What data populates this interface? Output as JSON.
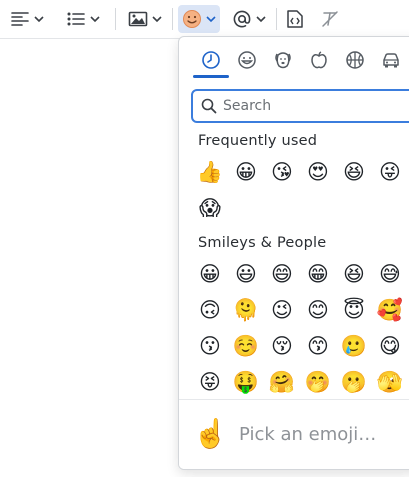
{
  "toolbar": {
    "buttons": [
      {
        "icon": "align-left-icon"
      },
      {
        "icon": "bulleted-list-icon"
      },
      {
        "icon": "image-icon"
      },
      {
        "icon": "emoji-icon"
      },
      {
        "icon": "mention-icon"
      },
      {
        "icon": "code-snippet-icon"
      },
      {
        "icon": "clear-formatting-icon"
      }
    ],
    "accent": "#dbe5f6"
  },
  "emoji_picker": {
    "categories": [
      {
        "name": "recent",
        "icon": "clock-icon"
      },
      {
        "name": "smileys",
        "icon": "smiley-icon"
      },
      {
        "name": "animals",
        "icon": "dog-icon"
      },
      {
        "name": "food",
        "icon": "apple-icon"
      },
      {
        "name": "activity",
        "icon": "basketball-icon"
      },
      {
        "name": "travel",
        "icon": "car-icon"
      }
    ],
    "search_placeholder": "Search",
    "sections": {
      "frequent": {
        "title": "Frequently used",
        "emojis": [
          "👍",
          "😀",
          "😘",
          "😍",
          "😆",
          "😜",
          "😱"
        ]
      },
      "smileys": {
        "title": "Smileys & People",
        "emojis": [
          "😀",
          "😃",
          "😄",
          "😁",
          "😆",
          "😅",
          "🙃",
          "🫠",
          "😉",
          "😊",
          "😇",
          "🥰",
          "😗",
          "☺️",
          "😚",
          "😙",
          "🥲",
          "😋",
          "😝",
          "🤑",
          "🤗",
          "🤭",
          "🫢",
          "🫣"
        ]
      }
    },
    "preview": {
      "emoji": "☝️",
      "text": "Pick an emoji…"
    },
    "accent_color": "#1e63c9"
  }
}
